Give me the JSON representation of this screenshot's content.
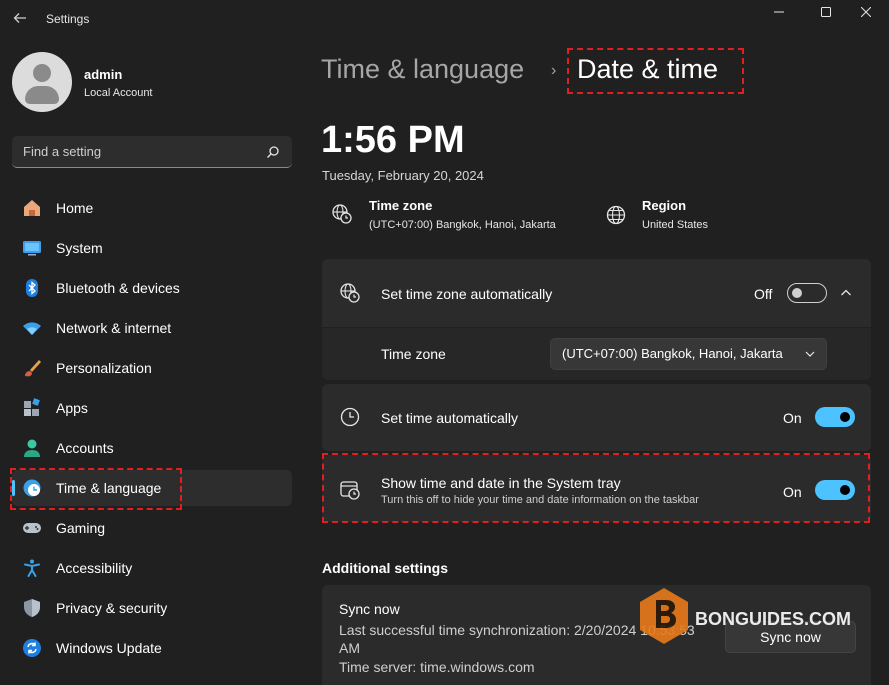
{
  "window": {
    "title": "Settings"
  },
  "profile": {
    "name": "admin",
    "account_type": "Local Account"
  },
  "search": {
    "placeholder": "Find a setting"
  },
  "sidebar": {
    "items": [
      {
        "label": "Home",
        "icon": "home-icon"
      },
      {
        "label": "System",
        "icon": "system-icon"
      },
      {
        "label": "Bluetooth & devices",
        "icon": "bluetooth-icon"
      },
      {
        "label": "Network & internet",
        "icon": "network-icon"
      },
      {
        "label": "Personalization",
        "icon": "personalization-icon"
      },
      {
        "label": "Apps",
        "icon": "apps-icon"
      },
      {
        "label": "Accounts",
        "icon": "accounts-icon"
      },
      {
        "label": "Time & language",
        "icon": "time-language-icon",
        "active": true
      },
      {
        "label": "Gaming",
        "icon": "gaming-icon"
      },
      {
        "label": "Accessibility",
        "icon": "accessibility-icon"
      },
      {
        "label": "Privacy & security",
        "icon": "privacy-icon"
      },
      {
        "label": "Windows Update",
        "icon": "windows-update-icon"
      }
    ]
  },
  "breadcrumb": {
    "parent": "Time & language",
    "separator": "›",
    "current": "Date & time"
  },
  "clock": {
    "time": "1:56 PM",
    "date": "Tuesday, February 20, 2024"
  },
  "info": {
    "timezone": {
      "title": "Time zone",
      "value": "(UTC+07:00) Bangkok, Hanoi, Jakarta"
    },
    "region": {
      "title": "Region",
      "value": "United States"
    }
  },
  "settings": {
    "auto_timezone": {
      "label": "Set time zone automatically",
      "state": "Off"
    },
    "timezone_select": {
      "label": "Time zone",
      "value": "(UTC+07:00) Bangkok, Hanoi, Jakarta"
    },
    "auto_time": {
      "label": "Set time automatically",
      "state": "On"
    },
    "system_tray": {
      "label": "Show time and date in the System tray",
      "description": "Turn this off to hide your time and date information on the taskbar",
      "state": "On"
    }
  },
  "additional": {
    "heading": "Additional settings",
    "sync": {
      "title": "Sync now",
      "last_sync_line1": "Last successful time synchronization: 2/20/2024 10:53:53",
      "last_sync_line2": "AM",
      "server": "Time server: time.windows.com",
      "button": "Sync now"
    }
  },
  "watermark": {
    "text": "BONGUIDES.COM"
  },
  "colors": {
    "accent": "#4cc2ff",
    "highlight": "#e02020",
    "background": "#202020",
    "card": "#2b2b2b"
  }
}
